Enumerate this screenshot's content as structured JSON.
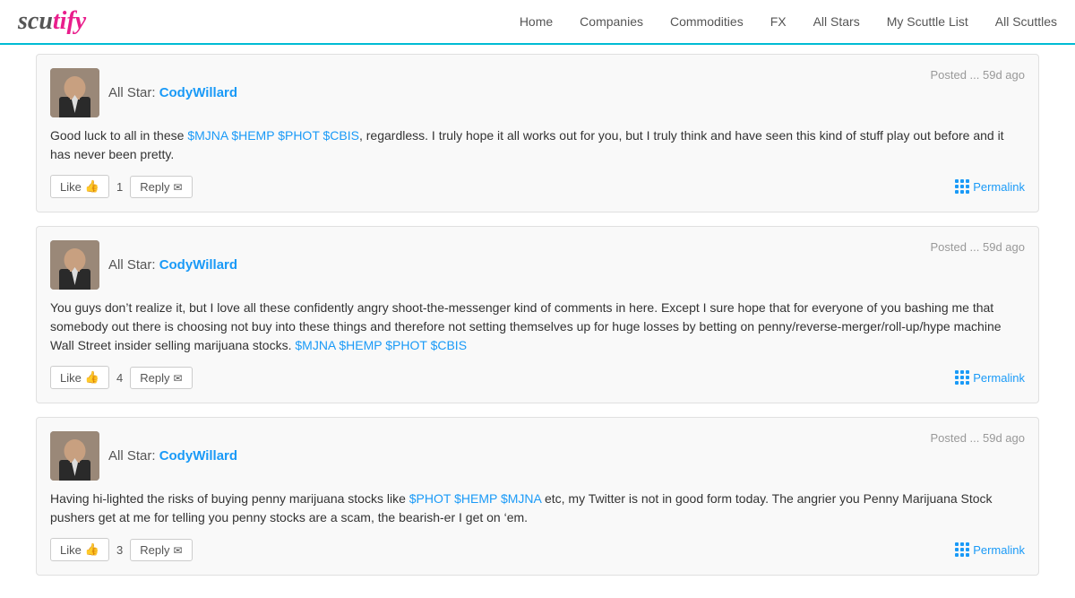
{
  "nav": {
    "logo_scu": "scu",
    "logo_tify": "tify",
    "links": [
      {
        "label": "Home",
        "href": "#"
      },
      {
        "label": "Companies",
        "href": "#"
      },
      {
        "label": "Commodities",
        "href": "#"
      },
      {
        "label": "FX",
        "href": "#"
      },
      {
        "label": "All Stars",
        "href": "#"
      },
      {
        "label": "My Scuttle List",
        "href": "#"
      },
      {
        "label": "All Scuttles",
        "href": "#"
      }
    ]
  },
  "posts": [
    {
      "id": 1,
      "author_prefix": "All Star: ",
      "author_name": "CodyWillard",
      "time": "Posted ... 59d ago",
      "body_before": "Good luck to all in these ",
      "stocks": "$MJNA $HEMP $PHOT $CBIS",
      "body_after": ", regardless. I truly hope it all works out for you, but I truly think and have seen this kind of stuff play out before and it has never been pretty.",
      "like_count": "1",
      "like_label": "Like",
      "reply_label": "Reply",
      "permalink_label": "Permalink"
    },
    {
      "id": 2,
      "author_prefix": "All Star: ",
      "author_name": "CodyWillard",
      "time": "Posted ... 59d ago",
      "body_before": "You guys don’t realize it, but I love all these confidently angry shoot-the-messenger kind of comments in here. Except I sure hope that for everyone of you bashing me that somebody out there is choosing not buy into these things and therefore not setting themselves up for huge losses by betting on penny/reverse-merger/roll-up/hype machine Wall Street insider selling marijuana stocks. ",
      "stocks": "$MJNA $HEMP $PHOT $CBIS",
      "body_after": "",
      "like_count": "4",
      "like_label": "Like",
      "reply_label": "Reply",
      "permalink_label": "Permalink"
    },
    {
      "id": 3,
      "author_prefix": "All Star: ",
      "author_name": "CodyWillard",
      "time": "Posted ... 59d ago",
      "body_before": "Having hi-lighted the risks of buying penny marijuana stocks like ",
      "stocks": "$PHOT $HEMP $MJNA",
      "body_after": " etc, my Twitter is not in good form today. The angrier you Penny Marijuana Stock pushers get at me for telling you penny stocks are a scam, the bearish-er I get on ‘em.",
      "like_count": "3",
      "like_label": "Like",
      "reply_label": "Reply",
      "permalink_label": "Permalink"
    }
  ]
}
